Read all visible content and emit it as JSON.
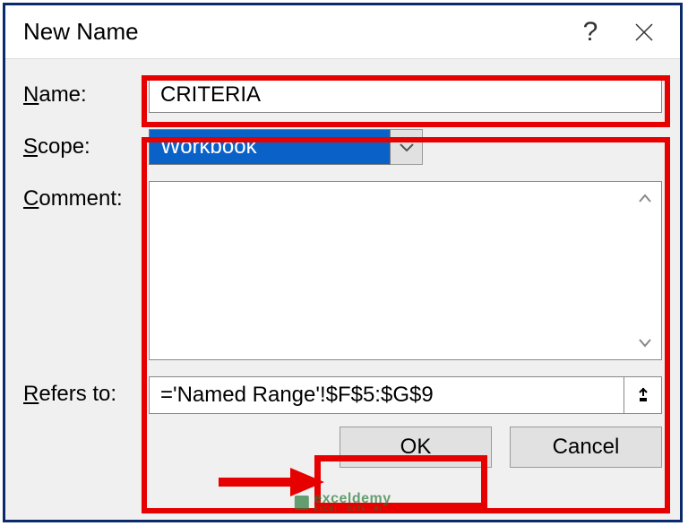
{
  "title": "New Name",
  "labels": {
    "name": "Name:",
    "scope": "Scope:",
    "comment": "Comment:",
    "refers": "Refers to:"
  },
  "fields": {
    "name_value": "CRITERIA",
    "scope_value": "Workbook",
    "comment_value": "",
    "refers_value": "='Named Range'!$F$5:$G$9"
  },
  "buttons": {
    "ok": "OK",
    "cancel": "Cancel"
  },
  "watermark": {
    "main": "exceldemy",
    "sub": "EXCEL · DATA · BI"
  }
}
